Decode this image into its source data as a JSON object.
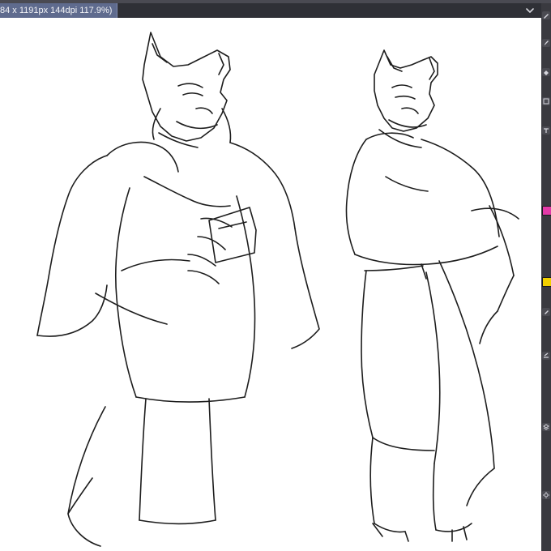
{
  "window": {
    "tab_title": "84 x 1191px 144dpi 117.9%)",
    "menu_icon": "chevron-down-icon"
  },
  "canvas": {
    "content": "sketch-illustration",
    "subject": "two anthropomorphic wolf characters (line sketch)"
  },
  "tools": {
    "right_toolbar": [
      "pen-icon",
      "brush-icon",
      "eraser-icon",
      "selection-icon",
      "text-icon",
      "color-picker-icon",
      "highlighter-icon",
      "layer-icon",
      "settings-icon"
    ],
    "colors": {
      "accent_purple": "#6f5bd7",
      "accent_pink": "#e43aa8",
      "accent_yellow": "#f2d000",
      "ui_blue": "#5f6b8e"
    }
  }
}
